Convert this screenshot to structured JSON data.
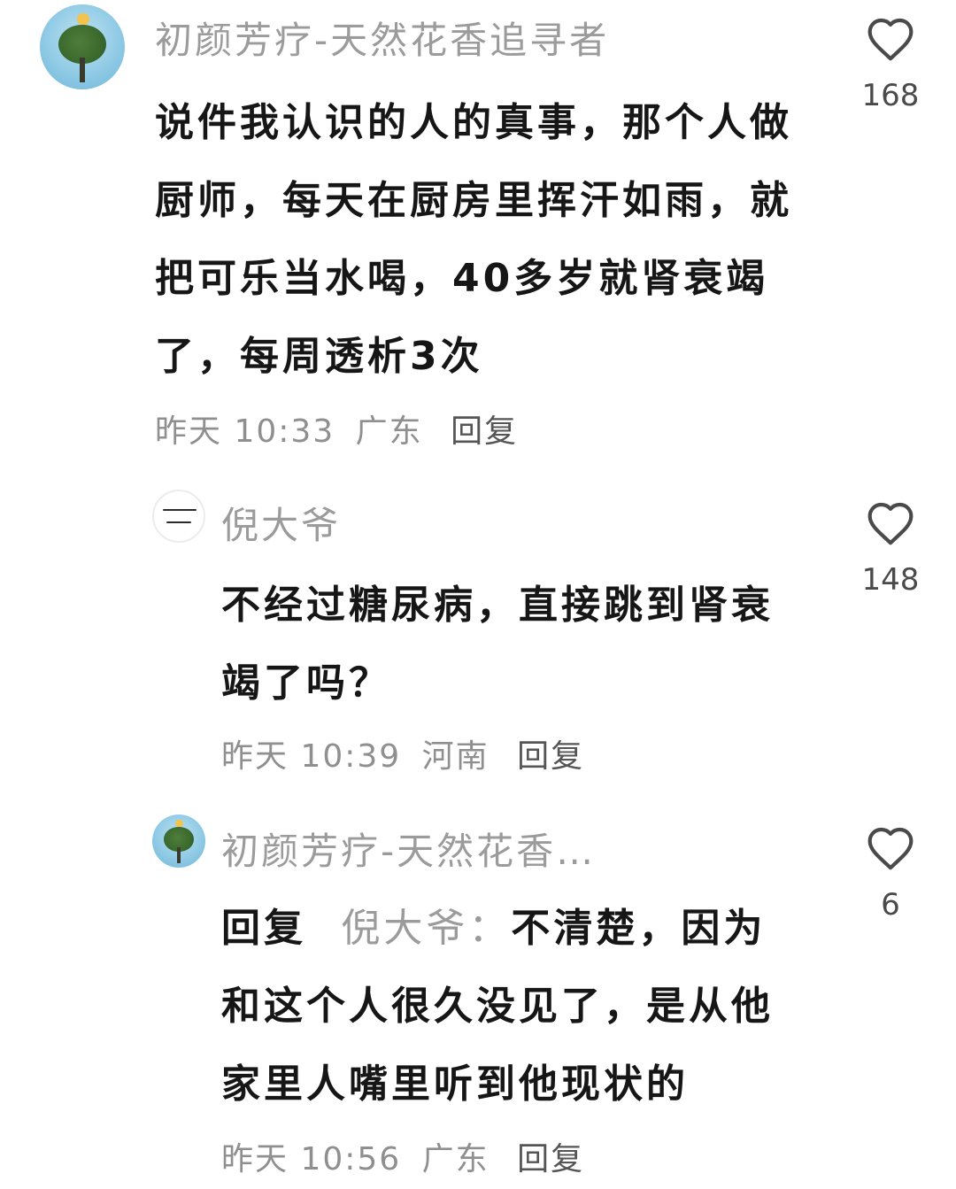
{
  "comments": [
    {
      "username": "初颜芳疗-天然花香追寻者",
      "text": "说件我认识的人的真事，那个人做厨师，每天在厨房里挥汗如雨，就把可乐当水喝，40多岁就肾衰竭了，每周透析3次",
      "time": "昨天 10:33",
      "location": "广东",
      "reply_label": "回复",
      "likes": "168"
    },
    {
      "username": "倪大爷",
      "text": "不经过糖尿病，直接跳到肾衰竭了吗？",
      "time": "昨天 10:39",
      "location": "河南",
      "reply_label": "回复",
      "likes": "148"
    },
    {
      "username": "初颜芳疗-天然花香…",
      "reply_prefix": "回复",
      "reply_to": "倪大爷：",
      "text": "不清楚，因为和这个人很久没见了，是从他家里人嘴里听到他现状的",
      "time": "昨天 10:56",
      "location": "广东",
      "reply_label": "回复",
      "likes": "6"
    }
  ],
  "colors": {
    "text": "#161616",
    "username": "#9b9b9b",
    "meta": "#8f8f8f",
    "icon": "#4a4a4a"
  },
  "icons": {
    "like": "heart-outline-icon"
  }
}
